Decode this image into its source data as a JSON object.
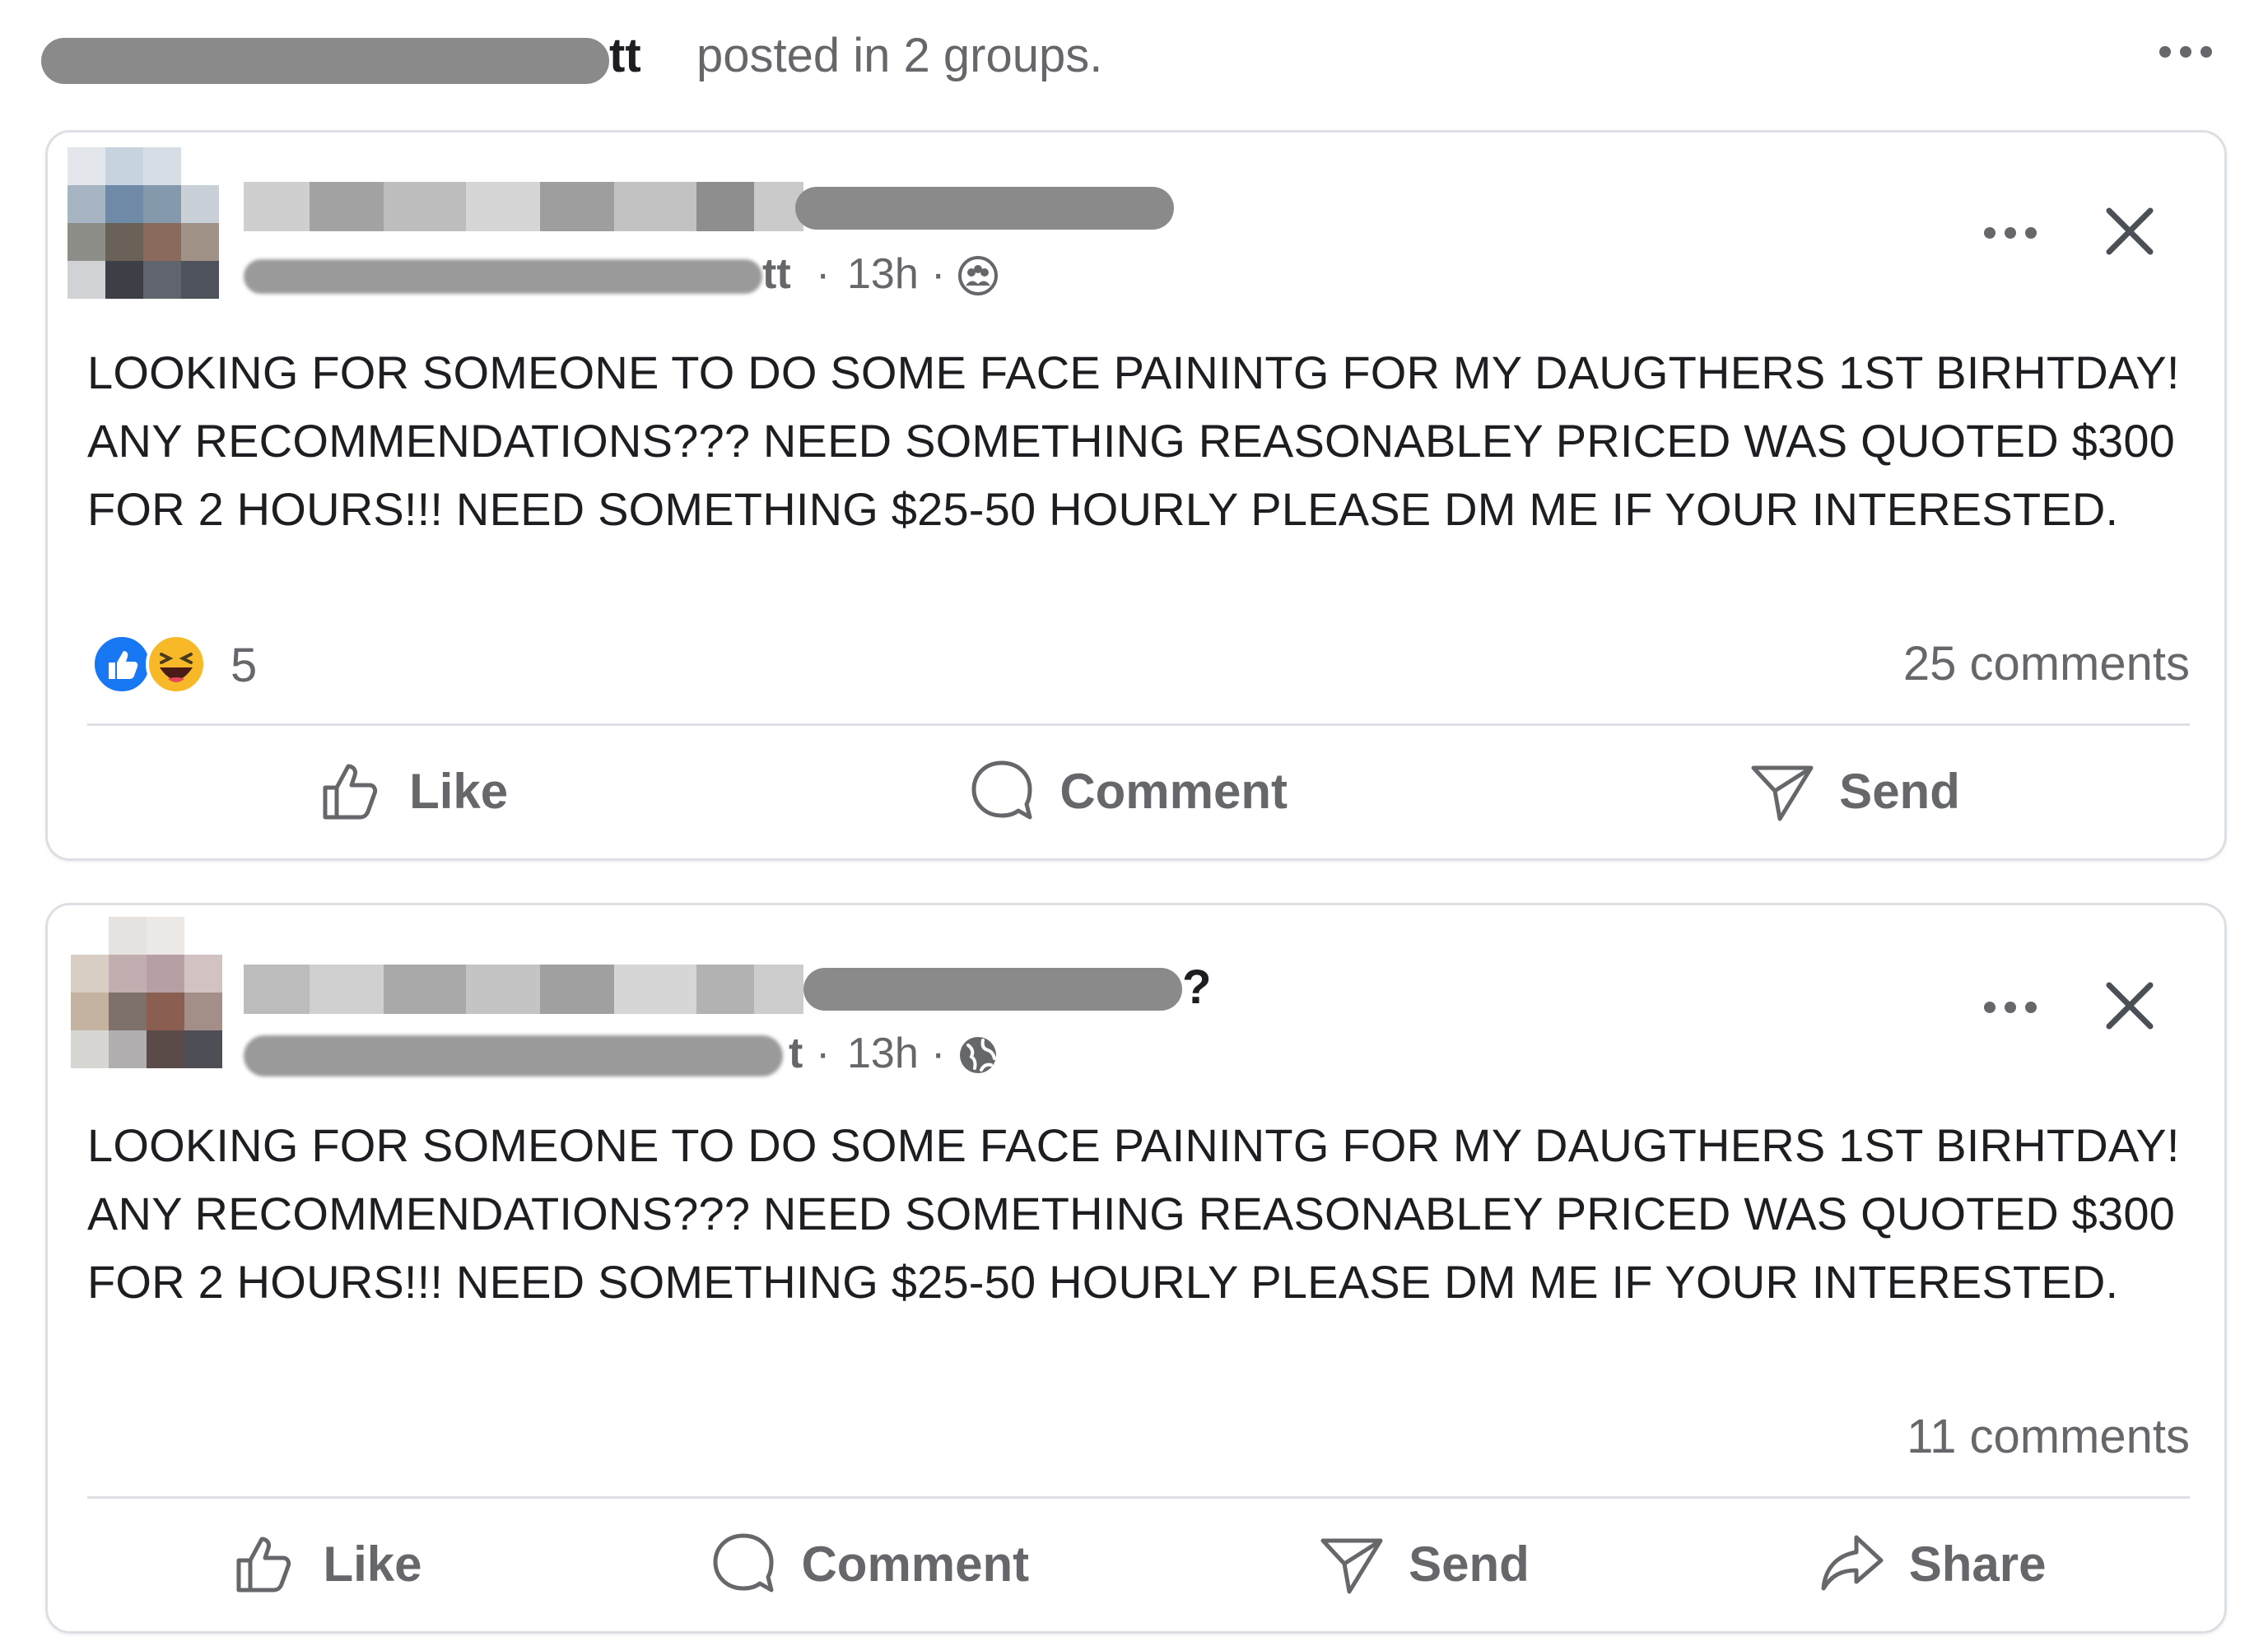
{
  "header": {
    "poster_name_visible": "tt",
    "posted_text": "posted in 2 groups."
  },
  "posts": [
    {
      "group_name_visible": "",
      "poster_name_visible": "tt",
      "time": "13h",
      "separator": "·",
      "privacy_icon": "group-icon",
      "text": "LOOKING FOR SOMEONE TO DO SOME FACE PAININTG FOR MY DAUGTHERS 1ST BIRHTDAY! ANY RECOMMENDATIONS??? NEED SOMETHING REASONABLEY PRICED WAS QUOTED $300 FOR 2 HOURS!!! NEED SOMETHING $25-50 HOURLY PLEASE DM ME IF YOUR INTERESTED.",
      "reaction_count": "5",
      "comments": "25 comments",
      "actions": {
        "like": "Like",
        "comment": "Comment",
        "send": "Send"
      }
    },
    {
      "group_name_visible": "?",
      "poster_name_visible": "t",
      "time": "13h",
      "separator": "·",
      "privacy_icon": "globe-icon",
      "text": "LOOKING FOR SOMEONE TO DO SOME FACE PAININTG FOR MY DAUGTHERS 1ST BIRHTDAY! ANY RECOMMENDATIONS??? NEED SOMETHING REASONABLEY PRICED WAS QUOTED $300 FOR 2 HOURS!!! NEED SOMETHING $25-50 HOURLY PLEASE DM ME IF YOUR INTERESTED.",
      "comments": "11 comments",
      "actions": {
        "like": "Like",
        "comment": "Comment",
        "send": "Send",
        "share": "Share"
      }
    }
  ],
  "colors": {
    "text_primary": "#1c1e21",
    "text_secondary": "#65676b",
    "like_blue": "#1877f2",
    "haha_yellow": "#f7b928",
    "border": "#dcdfe3"
  }
}
